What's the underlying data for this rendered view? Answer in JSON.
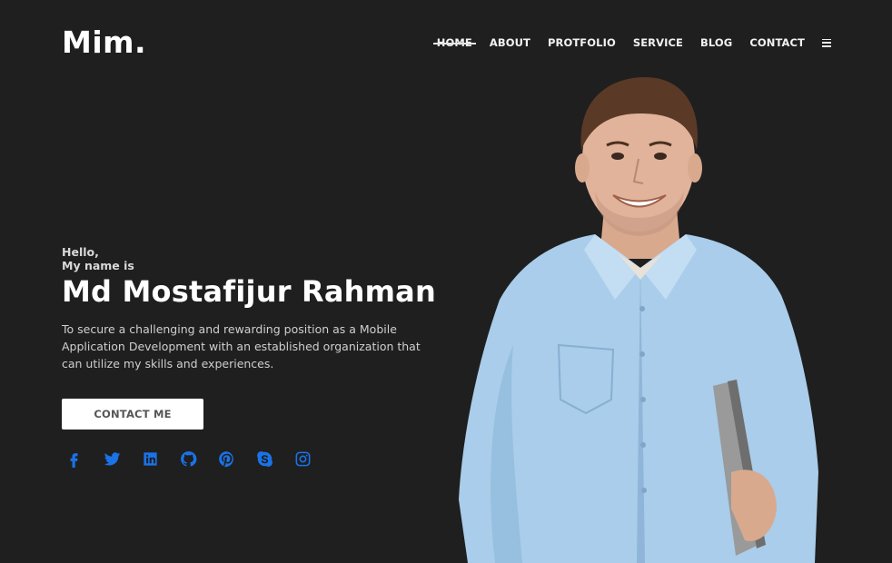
{
  "brand": {
    "logo_text": "Mim."
  },
  "nav": {
    "items": [
      {
        "label": "HOME"
      },
      {
        "label": "ABOUT"
      },
      {
        "label": "PROTFOLIO"
      },
      {
        "label": "SERVICE"
      },
      {
        "label": "BLOG"
      },
      {
        "label": "CONTACT"
      }
    ],
    "active": "HOME"
  },
  "hero": {
    "greeting_line1": "Hello,",
    "greeting_line2": "My name is",
    "name": "Md Mostafijur Rahman",
    "description": "To secure a challenging and rewarding position as a Mobile Application Development with an established organization that can utilize my skills and experiences.",
    "cta_label": "CONTACT ME"
  },
  "socials": [
    {
      "icon": "facebook-icon"
    },
    {
      "icon": "twitter-icon"
    },
    {
      "icon": "linkedin-icon"
    },
    {
      "icon": "github-icon"
    },
    {
      "icon": "pinterest-icon"
    },
    {
      "icon": "skype-icon"
    },
    {
      "icon": "instagram-icon"
    }
  ],
  "colors": {
    "background": "#1f1f1f",
    "social_blue": "#1a73e8",
    "button_bg": "#ffffff",
    "shirt": "#a9cdea"
  }
}
